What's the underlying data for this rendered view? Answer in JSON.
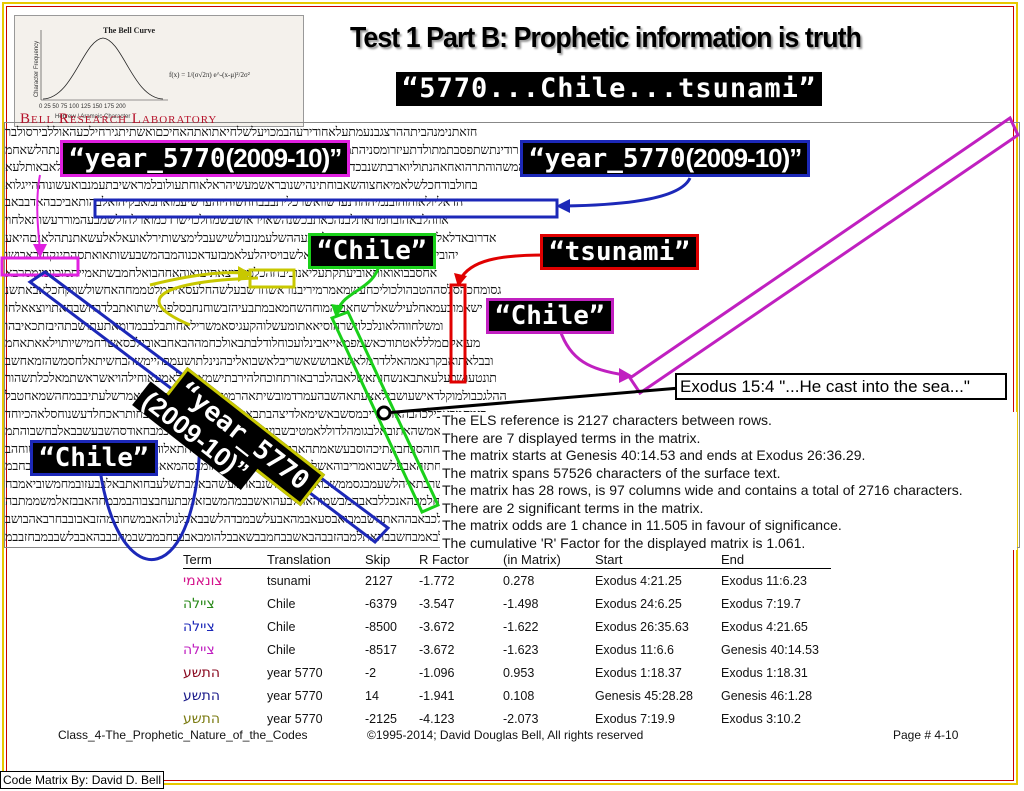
{
  "header": {
    "title": "Test 1 Part B:  Prophetic information is truth",
    "subtitle": "“5770...Chile...tsunami”"
  },
  "logo": {
    "chart_title": "The Bell Curve",
    "y_label": "Character Frequency",
    "x_label": "Hebrew / Aramaic Character",
    "x_ticks": "0   25   50   75  100  125  150  175  200",
    "formula": "f(x) = 1/(σ√2π) e^-(x-μ)²/2σ²",
    "lab_name": "Bell Research Laboratory"
  },
  "labels": {
    "year_left": "“year_5770",
    "year_left_paren": "(2009-10)”",
    "year_right": "“year_5770",
    "year_right_paren": "(2009-10)”",
    "chile_top": "“Chile”",
    "tsunami": "“tsunami”",
    "chile_right": "“Chile”",
    "chile_left": "“Chile”",
    "year_rotated_1": "“year_5770",
    "year_rotated_2": "(2009-10)”",
    "exodus_ref": "Exodus 15:4 \"...He cast into the sea...\""
  },
  "matrix_rows": [
    "חזאתנימנהביתההרצגבנעמתעלאחודירעהבמכויעלשלחיאתואתהאחיכםואשתיתגירחילכעהאוללבירסולבר",
    "רודינתשתפסבתמתולדתעיזרומסניהתמשהסוראשכבמיעהפנייאלשחצמואתשבירעהמכניעהבנעיהאימענתהלשאחמ",
    "המשהוהתרהואחאהנתוליוארבתשנבכדמהסנויאאמושבכשכלימואתתבלחימבשמיבכושבחאתוהיובתםרכלאבאותלעא",
    "בחולבודחכלשלאמיאחצוהשאבוחתינהישנובראשמעשיהראלאוחתעולובלמראשיבתעמנבואעשונוההייגלוא",
    "הדאליולאוהוהובנמיההודנעדשוואשרכליתבבבחחשוהיוהערשיעמואתמאבקיהואלבהותאביכבהאדבבאב",
    "אוזהלבאהובחמתאתלבנהכאתבכשנהשאויראושבשמחלכוישרדכמוארלהולשמבעהמוררעשותאלחוי",
    "אדרובאדלאלאנישתהבאתרואמרמאבלשבעההשלעמנזבולשישעבלימצשותירלאועאלאלעשאתנתהלאנםהיאע",
    "יהובירישאכלונבארפמחכדחרותוןאלשבויסיהלעלאמבזעדאכנוהמבהמשבעשותאואתסהתינקחובאבושו",
    "אחסבבואואותאוביעתקתעליאנוכיבחהכלמצריצאתיעואוהאחהבואלחמבשתאמייתסוכוומימסרבא",
    "גסומחכהסלסההטבהולכוליכחעשמאמרמיריבנוראשחרשבעלשהחלעסאיתמלטממחהאחשולשויקחכלאבאתשנ",
    "ישאמובעמאחלעילשאלרשחאביהמוחהשחמאבמתבעיהזבשוחנחבסלפנמישתואתבלדבחשבחאתויוצאאלחו",
    "ומשלחווהלאונלכלוישרהוסיאאתומעשלוהקעגיסאמשרילאחותבלבבמדומאתעתושבתהיבזתכאיבהו",
    "מעיאקםמלללאטתודכאשמפמאייאבינלועכוחלודלבתבאולכחמההבאחבאובילכסאשרחמישיותוילאאתאחמ",
    "ובבלאתואבקרנאמהאללדרמלאשאבוששאשריבלאשבואליבהנינלתושעמבהיימשהבחשיתאלחסמשהזמאחשב",
    "תונטעושכעלעאתבאנשחותאשלאבהלברבאזרתחוכחלהירבתישמאבהילאמעאוחילהויאשראשתמאלכלתשהור",
    "ההלגכבולמוקלדאישעושבילאצעתאהשבהעמרדמובשיתאהרמטבעהעשתחרבזאתאמרשלעתיבבמחהשמאחטבל",
    "רימחמבאבילכהבהאדנהריבמסשבאשימאלדיצהבתבאובחטובהשמעתאבאויבחותראכחלדעשנוחסלאהכיוחד",
    "אמראבמבשמאמשהאתובאלבגומהלדוללאמטיבשבויתחוהלכבאחמואיאשרכמבחאודסהשבעשבבאלבחשבוהתמ",
    "ימובאשיהצהלחוהסבחבאתיכהוסבעשאמתהאבביהסשמאלוכשבהאתוחתאלוהליבמבלאשאביאמההאתמשוחהב",
    "וכאחמדבחתזהאבעלשבואמריבוהאשלאהלבשרממתיבומללהומבסהמאאהבבשימיאחלעהמדליתזהלעבחבמ",
    "ושבהלסאמשרבתאיהלשעמבגסממשבוארהלכאחשנבאהמעשהבאמבתשלעבחואתבאלבבעזובמחמשוביאמבח",
    "אבעתחבהלחלמבהאנכללבאבהמבשמוהאחלבעהואשבבמהמשבזאמבתעחבצבוהבמבמחהאבבזאלמשממתבה",
    "ימהבכאללכבאבההאתחשבמבואבסעאבמהאבעלשבמבדהלשבבאכלנולהאבמשחובמהזבאבובבחרבאהבושב",
    "אמשבלהאבלבאמבחשבבהאתלמבהזבבהבאשבבחמבבשאבבלהומבאבבבחבמבשבמהבבבהאבבלשבבמבחזבבמ"
  ],
  "info_lines": [
    "The ELS reference is 2127 characters between rows.",
    "There are 7 displayed terms in the matrix.",
    "The matrix starts at Genesis 40:14.53 and ends at Exodus 26:36.29.",
    "The matrix spans 57526 characters of the surface text.",
    "The matrix has 28 rows, is 97 columns wide and contains a total of 2716 characters.",
    "There are 2 significant terms in the matrix.",
    "The matrix odds are 1 chance in 11.505 in favour of significance.",
    "The cumulative 'R' Factor for the displayed matrix is 1.061."
  ],
  "table": {
    "headers": [
      "Term",
      "Translation",
      "Skip",
      "R Factor",
      "(in Matrix)",
      "Start",
      "End"
    ],
    "rows": [
      {
        "term": "צונאמי",
        "color": "#d4148c",
        "translation": "tsunami",
        "skip": "2127",
        "r": "-1.772",
        "in_matrix": "0.278",
        "start": "Exodus 4:21.25",
        "end": "Exodus 11:6.23"
      },
      {
        "term": "ציילה",
        "color": "#2a8a1a",
        "translation": "Chile",
        "skip": "-6379",
        "r": "-3.547",
        "in_matrix": "-1.498",
        "start": "Exodus 24:6.25",
        "end": "Exodus 7:19.7"
      },
      {
        "term": "ציילה",
        "color": "#1c28b8",
        "translation": "Chile",
        "skip": "-8500",
        "r": "-3.672",
        "in_matrix": "-1.622",
        "start": "Exodus 26:35.63",
        "end": "Exodus 4:21.65"
      },
      {
        "term": "ציילה",
        "color": "#c020c0",
        "translation": "Chile",
        "skip": "-8517",
        "r": "-3.672",
        "in_matrix": "-1.623",
        "start": "Exodus 11:6.6",
        "end": "Genesis 40:14.53"
      },
      {
        "term": "התשע",
        "color": "#8a0a20",
        "translation": "year 5770",
        "skip": "-2",
        "r": "-1.096",
        "in_matrix": "0.953",
        "start": "Exodus 1:18.37",
        "end": "Exodus 1:18.31"
      },
      {
        "term": "התשע",
        "color": "#1a1a8a",
        "translation": "year 5770",
        "skip": "14",
        "r": "-1.941",
        "in_matrix": "0.108",
        "start": "Genesis 45:28.28",
        "end": "Genesis 46:1.28"
      },
      {
        "term": "התשע",
        "color": "#7a7a10",
        "translation": "year 5770",
        "skip": "-2125",
        "r": "-4.123",
        "in_matrix": "-2.073",
        "start": "Exodus 7:19.9",
        "end": "Exodus 3:10.2"
      }
    ]
  },
  "footer": {
    "left": "Class_4-The_Prophetic_Nature_of_the_Codes",
    "center": "©1995-2014; David Douglas Bell, All rights reserved",
    "right": "Page # 4-10"
  },
  "credit": "Code Matrix By: David D. Bell"
}
